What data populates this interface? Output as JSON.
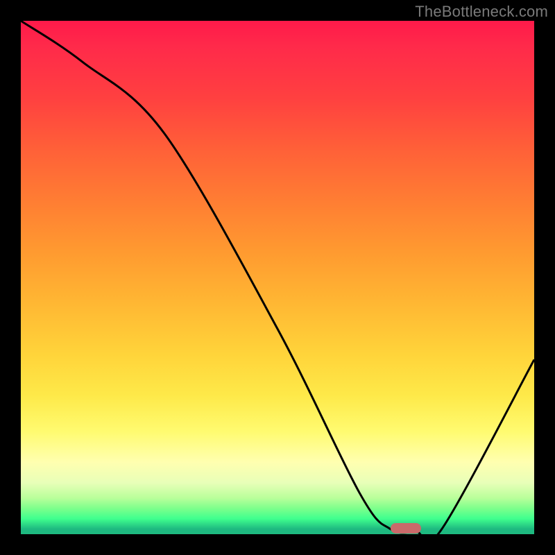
{
  "watermark": "TheBottleneck.com",
  "chart_data": {
    "type": "line",
    "title": "",
    "xlabel": "",
    "ylabel": "",
    "xlim": [
      0,
      100
    ],
    "ylim": [
      0,
      100
    ],
    "series": [
      {
        "name": "curve",
        "x": [
          0,
          12,
          28,
          50,
          66,
          72,
          77,
          82,
          100
        ],
        "values": [
          100,
          92,
          78,
          40,
          8,
          1,
          0.5,
          1,
          34
        ]
      }
    ],
    "annotations": [
      {
        "name": "highlight-bar",
        "x": 75,
        "y": 1.2,
        "width_pct": 6,
        "height_pct": 2
      }
    ],
    "background_gradient": {
      "top": "#ff1a4a",
      "mid": "#ffd43a",
      "bottom": "#1EB980"
    }
  }
}
